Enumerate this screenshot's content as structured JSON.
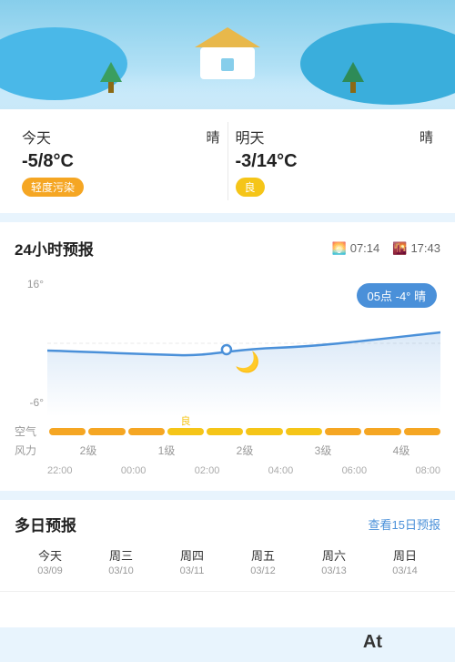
{
  "header": {
    "illustration_alt": "weather-header-illustration"
  },
  "today": {
    "label": "今天",
    "condition": "晴",
    "temp": "-5/8°C",
    "air_quality": "轻度污染",
    "air_badge_class": "badge-orange"
  },
  "tomorrow": {
    "label": "明天",
    "condition": "晴",
    "temp": "-3/14°C",
    "air_quality": "良",
    "air_badge_class": "badge-yellow"
  },
  "forecast24": {
    "title": "24小时预报",
    "sunrise": "07:14",
    "sunset": "17:43",
    "sunrise_icon": "🌅",
    "sunset_icon": "🌇",
    "tooltip": "05点 -4° 晴",
    "y_labels": [
      "16°",
      "",
      "-6°"
    ],
    "times": [
      "22:00",
      "00:00",
      "02:00",
      "04:00",
      "06:00",
      "08:00"
    ],
    "air_label": "空气",
    "wind_label": "风力",
    "wind_levels": [
      "2级",
      "1级",
      "2级",
      "3级",
      "4级"
    ],
    "good_label": "良"
  },
  "multiday": {
    "title": "多日预报",
    "link": "查看15日预报",
    "days": [
      {
        "label": "今天",
        "date": "03/09"
      },
      {
        "label": "周三",
        "date": "03/10"
      },
      {
        "label": "周四",
        "date": "03/11"
      },
      {
        "label": "周五",
        "date": "03/12"
      },
      {
        "label": "周六",
        "date": "03/13"
      },
      {
        "label": "周日",
        "date": "03/14"
      }
    ]
  },
  "bottom_text": "At"
}
